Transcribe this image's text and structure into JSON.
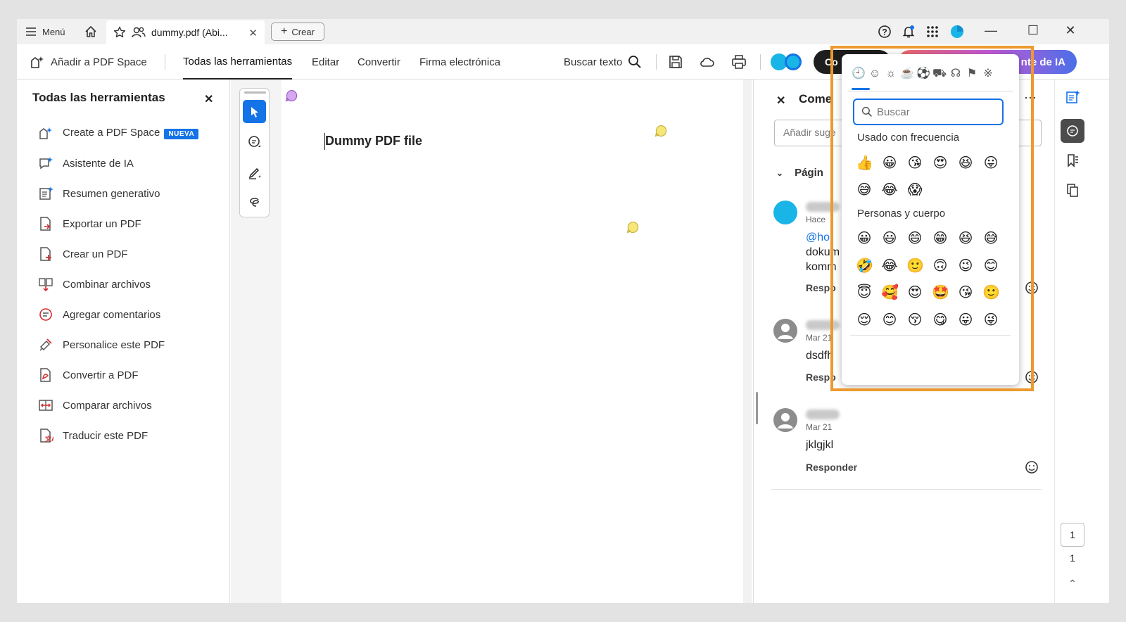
{
  "titlebar": {
    "menu_label": "Menú",
    "tab_label": "dummy.pdf (Abi...",
    "create_label": "Crear"
  },
  "toolbar": {
    "add_space_label": "Añadir a PDF Space",
    "tabs": [
      "Todas las herramientas",
      "Editar",
      "Convertir",
      "Firma electrónica"
    ],
    "search_label": "Buscar texto",
    "dark_button_label": "Co",
    "ai_button_label": "nte de IA"
  },
  "left_panel": {
    "title": "Todas las herramientas",
    "items": [
      {
        "label": "Create a PDF Space",
        "badge": "NUEVA"
      },
      {
        "label": "Asistente de IA"
      },
      {
        "label": "Resumen generativo"
      },
      {
        "label": "Exportar un PDF"
      },
      {
        "label": "Crear un PDF"
      },
      {
        "label": "Combinar archivos"
      },
      {
        "label": "Agregar comentarios"
      },
      {
        "label": "Personalice este PDF"
      },
      {
        "label": "Convertir a PDF"
      },
      {
        "label": "Comparar archivos"
      },
      {
        "label": "Traducir este PDF"
      }
    ]
  },
  "document": {
    "title": "Dummy PDF file"
  },
  "comments": {
    "title": "Come",
    "input_placeholder": "Añadir suge",
    "page_label": "Págin",
    "list": [
      {
        "date": "Hace",
        "lines": [
          "@hoi",
          "dokum",
          "komm"
        ],
        "reply": "Respo"
      },
      {
        "date": "Mar 21",
        "lines": [
          "dsdfh"
        ],
        "reply": "Respo"
      },
      {
        "date": "Mar 21",
        "lines": [
          "jklgjkl"
        ],
        "reply": "Responder"
      }
    ]
  },
  "pager": {
    "current": "1",
    "total": "1"
  },
  "emoji_picker": {
    "search_placeholder": "Buscar",
    "categories": [
      "recent-icon",
      "smiley-icon",
      "animal-icon",
      "food-icon",
      "sports-icon",
      "travel-icon",
      "objects-icon",
      "flags-icon",
      "symbols-icon"
    ],
    "sections": [
      {
        "title": "Usado con frecuencia",
        "rows": [
          [
            "👍",
            "😀",
            "😘",
            "😍",
            "😆",
            "😛"
          ],
          [
            "😅",
            "😂",
            "😱"
          ]
        ]
      },
      {
        "title": "Personas y cuerpo",
        "rows": [
          [
            "😀",
            "😃",
            "😄",
            "😁",
            "😆",
            "😅"
          ],
          [
            "🤣",
            "😂",
            "🙂",
            "🙃",
            "😉",
            "😊"
          ],
          [
            "😇",
            "🥰",
            "😍",
            "🤩",
            "😘",
            "🙂"
          ],
          [
            "😌",
            "😊",
            "😚",
            "😋",
            "😛",
            "😜"
          ]
        ]
      }
    ]
  },
  "colors": {
    "accent": "#1473e6",
    "highlight": "#ec9a2e"
  }
}
